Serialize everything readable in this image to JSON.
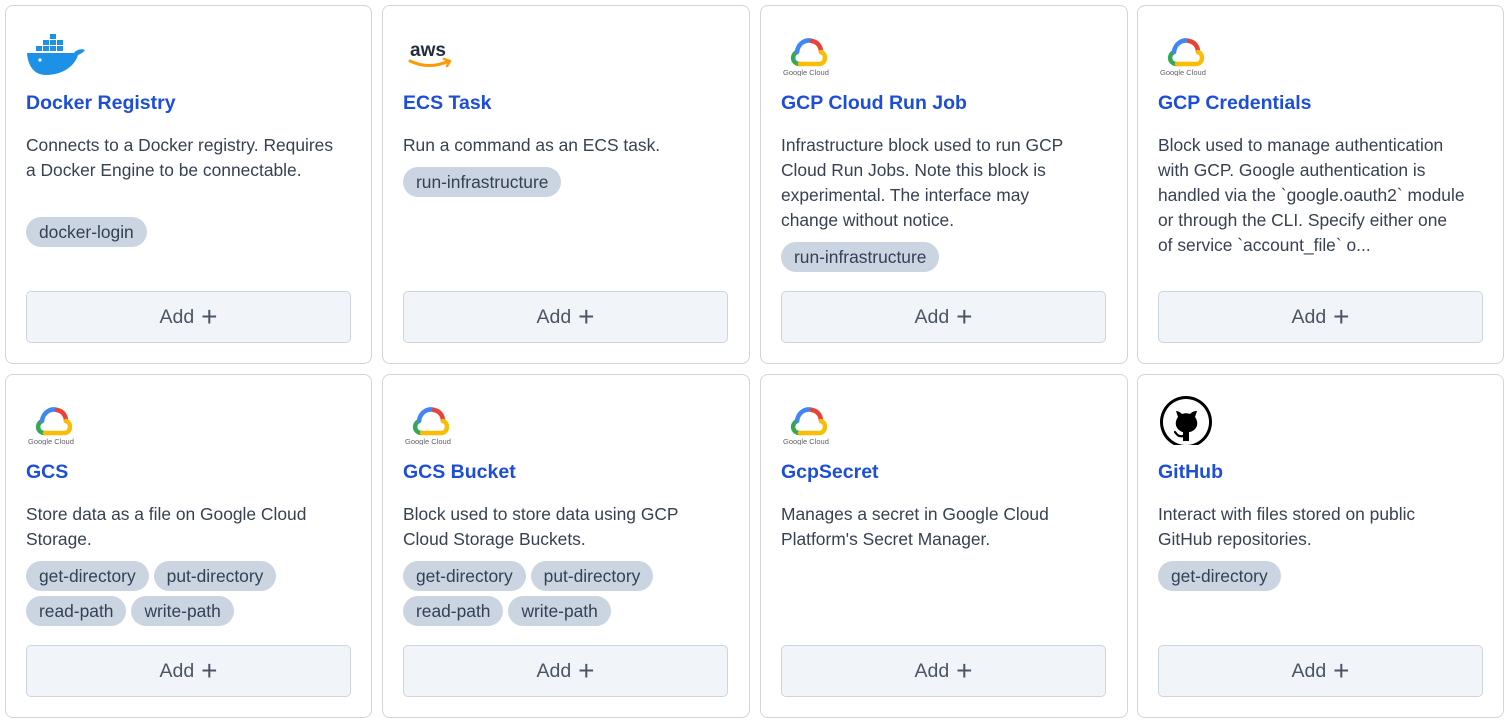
{
  "cards": [
    {
      "title": "Docker Registry",
      "logo": "docker-logo",
      "description": "Connects to a Docker registry. Requires a Docker Engine to be connectable.",
      "tags": [
        "docker-login"
      ],
      "add_label": "Add"
    },
    {
      "title": "ECS Task",
      "logo": "aws-logo",
      "logo_text": "aws",
      "description": "Run a command as an ECS task.",
      "tags": [
        "run-infrastructure"
      ],
      "add_label": "Add"
    },
    {
      "title": "GCP Cloud Run Job",
      "logo": "google-cloud-logo",
      "logo_text": "Google Cloud",
      "description": "Infrastructure block used to run GCP Cloud Run Jobs. Note this block is experimental. The interface may change without notice.",
      "tags": [
        "run-infrastructure"
      ],
      "add_label": "Add"
    },
    {
      "title": "GCP Credentials",
      "logo": "google-cloud-logo",
      "logo_text": "Google Cloud",
      "description": "Block used to manage authentication with GCP. Google authentication is handled via the `google.oauth2` module or through the CLI. Specify either one of service `account_file` o...",
      "tags": [],
      "add_label": "Add"
    },
    {
      "title": "GCS",
      "logo": "google-cloud-logo",
      "logo_text": "Google Cloud",
      "description": "Store data as a file on Google Cloud Storage.",
      "tags": [
        "get-directory",
        "put-directory",
        "read-path",
        "write-path"
      ],
      "add_label": "Add"
    },
    {
      "title": "GCS Bucket",
      "logo": "google-cloud-logo",
      "logo_text": "Google Cloud",
      "description": "Block used to store data using GCP Cloud Storage Buckets.",
      "tags": [
        "get-directory",
        "put-directory",
        "read-path",
        "write-path"
      ],
      "add_label": "Add"
    },
    {
      "title": "GcpSecret",
      "logo": "google-cloud-logo",
      "logo_text": "Google Cloud",
      "description": "Manages a secret in Google Cloud Platform's Secret Manager.",
      "tags": [],
      "add_label": "Add"
    },
    {
      "title": "GitHub",
      "logo": "github-logo",
      "description": "Interact with files stored on public GitHub repositories.",
      "tags": [
        "get-directory"
      ],
      "add_label": "Add"
    }
  ],
  "colors": {
    "title": "#1d4ed8",
    "chip_bg": "#cbd5e1",
    "button_bg": "#f1f5f9",
    "border": "#d1d5db"
  }
}
